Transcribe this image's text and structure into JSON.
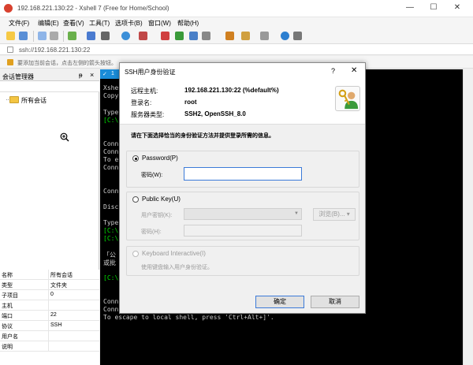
{
  "window": {
    "title": "192.168.221.130:22 - Xshell 7 (Free for Home/School)",
    "minimize": "—",
    "maximize": "☐",
    "close": "✕"
  },
  "menu": [
    "文件(F)",
    "编辑(E)",
    "查看(V)",
    "工具(T)",
    "选项卡(B)",
    "窗口(W)",
    "帮助(H)"
  ],
  "address": "ssh://192.168.221.130:22",
  "hint": "要添加当前会话，点击左侧的箭头按钮。",
  "session_panel": {
    "title": "会话管理器",
    "pin": "ᵽ",
    "close": "×",
    "tree_item": "所有会话"
  },
  "properties": [
    {
      "key": "名称",
      "value": "所有会话"
    },
    {
      "key": "类型",
      "value": "文件夹"
    },
    {
      "key": "子项目",
      "value": "0"
    },
    {
      "key": "主机",
      "value": ""
    },
    {
      "key": "端口",
      "value": "22"
    },
    {
      "key": "协议",
      "value": "SSH"
    },
    {
      "key": "用户名",
      "value": ""
    },
    {
      "key": "说明",
      "value": ""
    }
  ],
  "terminal": {
    "tab_label": "1",
    "lines": [
      "Xshe",
      "Copy",
      "",
      "Type",
      "[C:\\",
      "",
      "Conn",
      "Conn",
      "To e",
      "Conn",
      "",
      "Conn",
      "",
      "Disc",
      "",
      "Type",
      "[C:\\",
      "[C:\\",
      "",
      "「公",
      "或批",
      "",
      "[C:\\",
      "",
      "Conn",
      "Conn",
      "To escape to local shell, press 'Ctrl+Alt+]'."
    ]
  },
  "dialog": {
    "title": "SSH用户身份验证",
    "help": "?",
    "close": "✕",
    "info": [
      {
        "key": "远程主机:",
        "value": "192.168.221.130:22 (%default%)"
      },
      {
        "key": "登录名:",
        "value": "root"
      },
      {
        "key": "服务器类型:",
        "value": "SSH2, OpenSSH_8.0"
      }
    ],
    "instruction": "请在下面选择恰当的身份验证方法并提供登录所需的信息。",
    "password_group": {
      "radio_label": "Password(P)",
      "field_label": "密码(W):",
      "value": ""
    },
    "pubkey_group": {
      "radio_label": "Public Key(U)",
      "user_key_label": "用户密钥(K):",
      "browse_label": "浏览(B)...",
      "passphrase_label": "密码(H):"
    },
    "keyboard_group": {
      "radio_label": "Keyboard Interactive(I)",
      "description": "使用键盘输入用户身份验证。"
    },
    "ok_label": "确定",
    "cancel_label": "取消"
  }
}
